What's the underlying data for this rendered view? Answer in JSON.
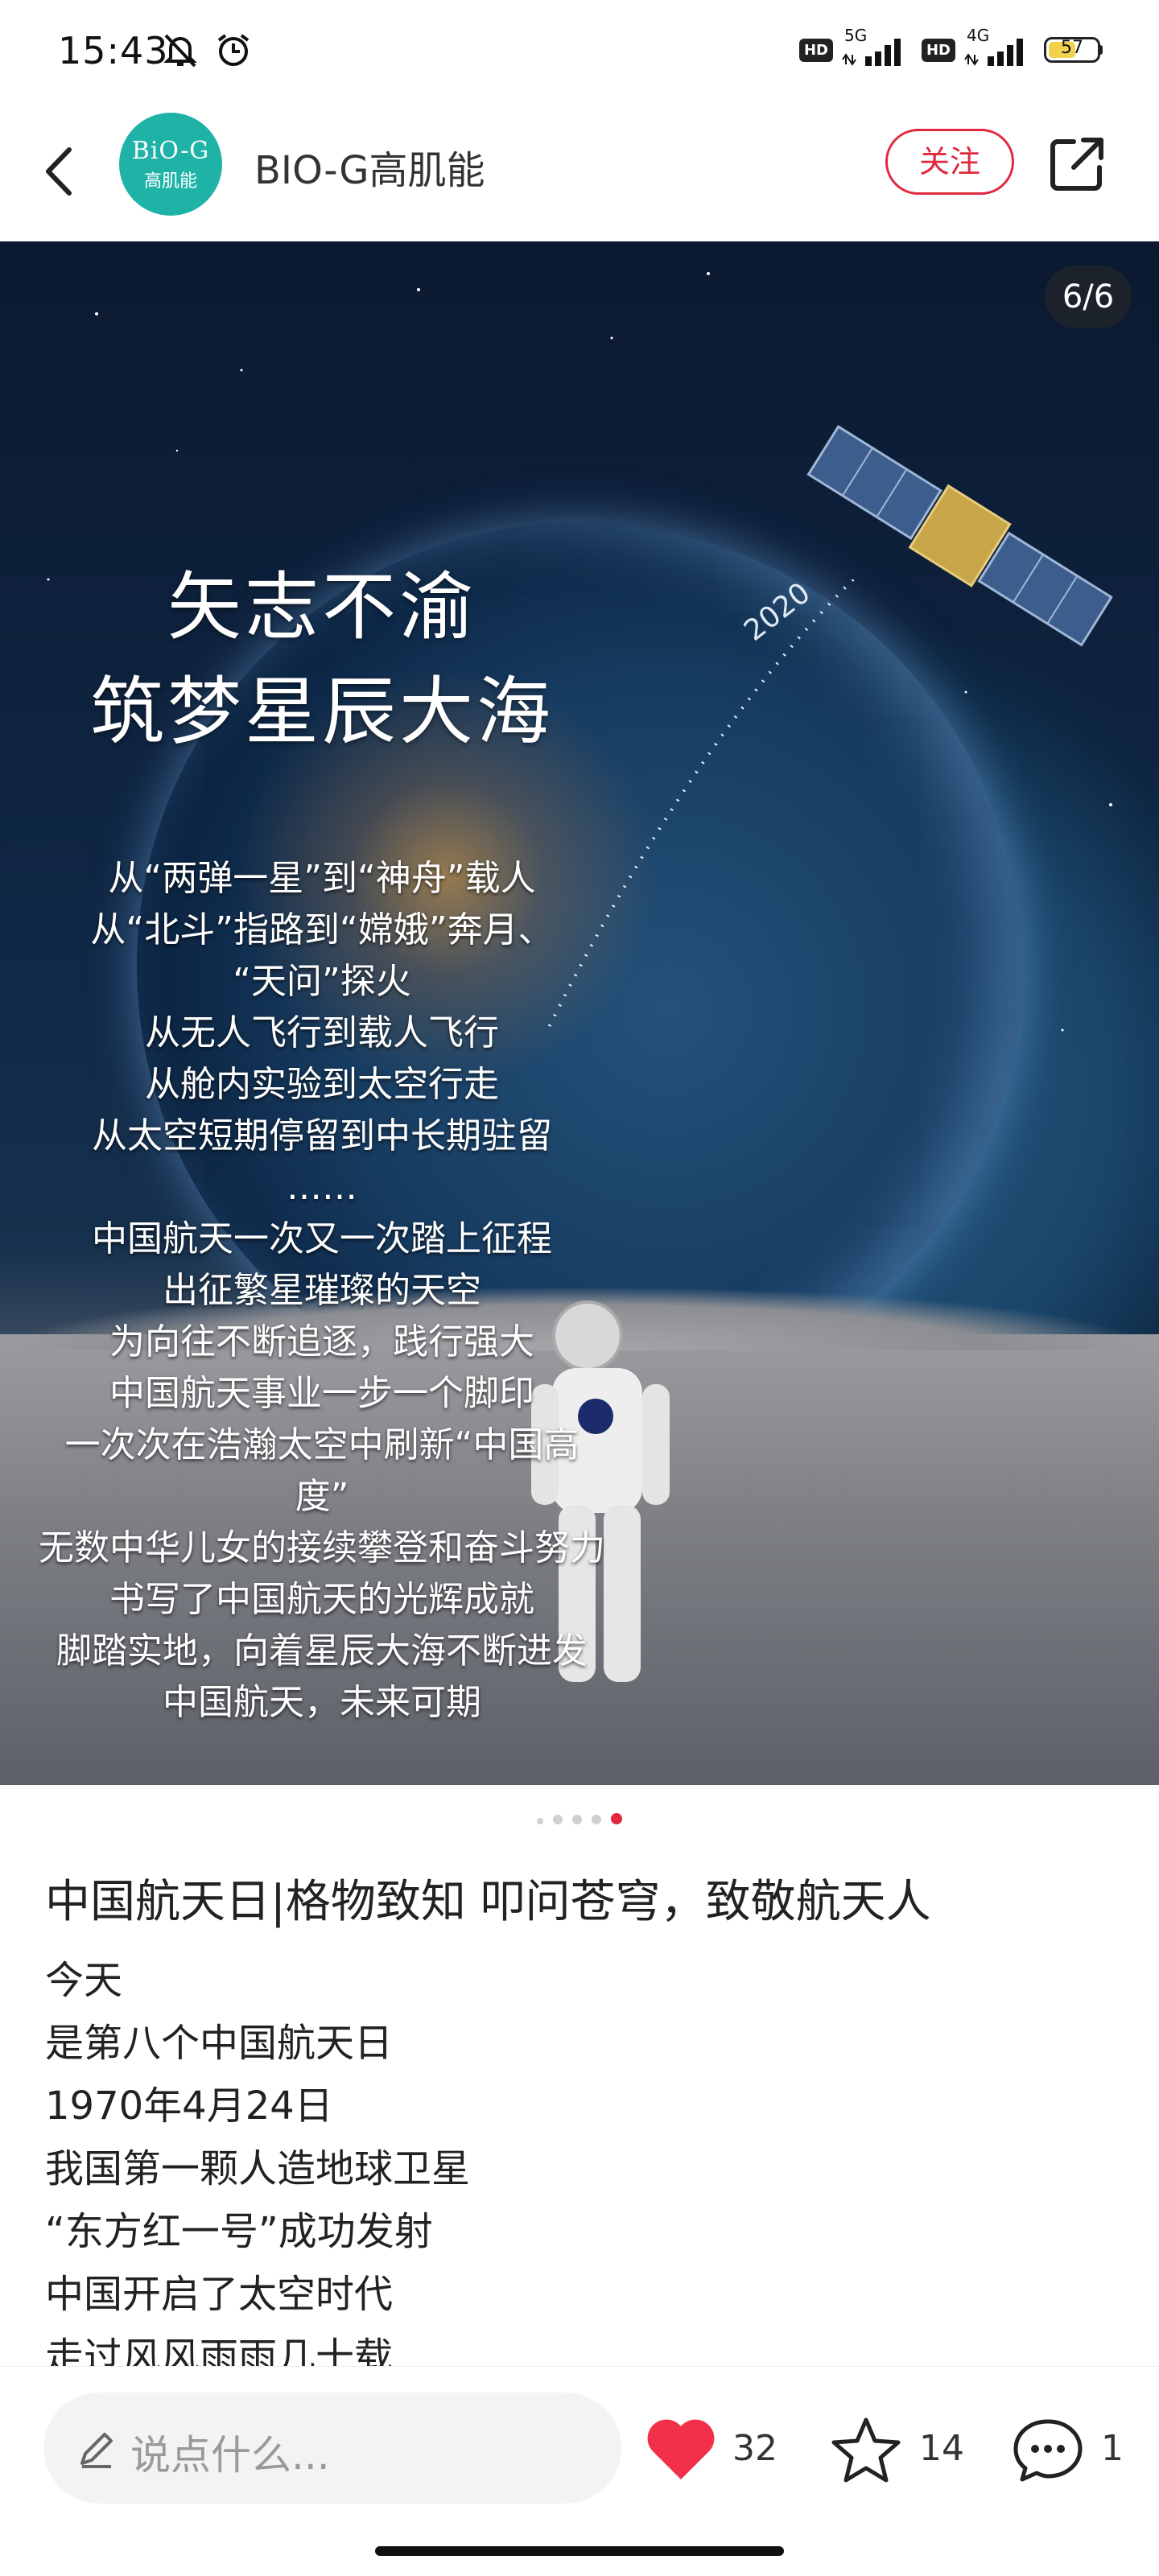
{
  "status_bar": {
    "time": "15:43",
    "net1": "5G",
    "net2": "4G",
    "hd": "HD",
    "battery": "57",
    "battery_level": 0.57,
    "icons": [
      "mute-bell-icon",
      "alarm-icon",
      "signal-icon",
      "battery-icon"
    ]
  },
  "header": {
    "avatar_text_top": "BiO-G",
    "avatar_text_bottom": "高肌能",
    "account_name": "BIO-G高肌能",
    "follow_label": "关注",
    "colors": {
      "accent": "#e0293e",
      "avatar_bg": "#1fb3a8"
    }
  },
  "carousel": {
    "counter": "6/6",
    "year_mark": "2020",
    "slogan_line1": "矢志不渝",
    "slogan_line2": "筑梦星辰大海",
    "poem": [
      "从“两弹一星”到“神舟”载人",
      "从“北斗”指路到“嫦娥”奔月、",
      "“天问”探火",
      "从无人飞行到载人飞行",
      "从舱内实验到太空行走",
      "从太空短期停留到中长期驻留",
      "……",
      "中国航天一次又一次踏上征程",
      "出征繁星璀璨的天空",
      "为向往不断追逐，践行强大",
      "中国航天事业一步一个脚印",
      "一次次在浩瀚太空中刷新“中国高",
      "度”",
      "无数中华儿女的接续攀登和奋斗努力",
      "书写了中国航天的光辉成就",
      "脚踏实地，向着星辰大海不断进发",
      "中国航天，未来可期"
    ],
    "total_pages": 6,
    "active_page": 6
  },
  "post": {
    "title": "中国航天日|格物致知 叩问苍穹，致敬航天人",
    "body": [
      "今天",
      "是第八个中国航天日",
      "1970年4月24日",
      "我国第一颗人造地球卫星",
      "“东方红一号”成功发射",
      "中国开启了太空时代",
      "走过风风雨雨几十载"
    ]
  },
  "bottom_bar": {
    "comment_placeholder": "说点什么...",
    "likes": "32",
    "favorites": "14",
    "comments": "1"
  }
}
